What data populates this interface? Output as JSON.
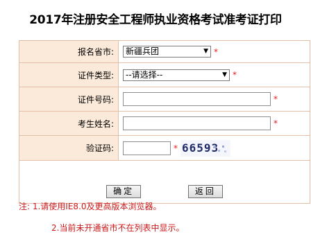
{
  "page": {
    "title": "2017年注册安全工程师执业资格考试准考证打印"
  },
  "form": {
    "province": {
      "label": "报名省市:",
      "value": "新疆兵团"
    },
    "id_type": {
      "label": "证件类型:",
      "value": "--请选择--"
    },
    "id_number": {
      "label": "证件号码:",
      "value": ""
    },
    "name": {
      "label": "考生姓名:",
      "value": ""
    },
    "captcha": {
      "label": "验证码:",
      "value": "",
      "image_text": "66593"
    },
    "required_mark": "*"
  },
  "buttons": {
    "confirm": "确定",
    "back": "返回"
  },
  "notes": {
    "line1": "注: 1.请使用IE8.0及更高版本浏览器。",
    "line2": "2.当前未开通省市不在列表中显示。"
  },
  "colors": {
    "label_bg": "#fbead9",
    "border": "#e3bfa8",
    "required": "#e02020",
    "note": "#cc1a1a"
  }
}
